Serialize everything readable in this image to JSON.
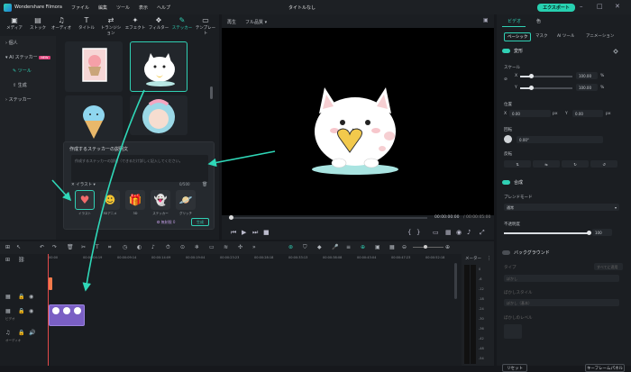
{
  "titlebar": {
    "app_name": "Wondershare Filmora",
    "menu": [
      "ファイル",
      "編集",
      "ツール",
      "表示",
      "ヘルプ"
    ],
    "doc_title": "タイトルなし",
    "export_label": "エクスポート"
  },
  "media_tabs": [
    {
      "label": "メディア",
      "icon": "media-icon"
    },
    {
      "label": "ストック",
      "icon": "stock-icon"
    },
    {
      "label": "オーディオ",
      "icon": "music-icon"
    },
    {
      "label": "タイトル",
      "icon": "text-icon"
    },
    {
      "label": "トランジション",
      "icon": "transition-icon"
    },
    {
      "label": "エフェクト",
      "icon": "effect-icon"
    },
    {
      "label": "フィルター",
      "icon": "filter-icon"
    },
    {
      "label": "ステッカー",
      "icon": "sticker-icon"
    },
    {
      "label": "テンプレート",
      "icon": "template-icon"
    }
  ],
  "sidebar": {
    "items": [
      "個人",
      "AI ステッカー",
      "ツール",
      "生成",
      "ステッカー"
    ],
    "new_badge": "NEW"
  },
  "dialog": {
    "title": "作成するステッカーの説明文",
    "placeholder": "作成するステッカーの説明（できるだけ詳しく記入してください。",
    "style_label": "イラスト",
    "counter": "0/500",
    "styles": [
      "イラスト",
      "3Dアニメ",
      "3D",
      "ステッカー",
      "グリッチ"
    ],
    "credits": "無制限",
    "credit_count": "0",
    "generate_label": "生成"
  },
  "preview": {
    "quality_label": "再生",
    "quality_value": "フル品質",
    "current_time": "00:00:00:00",
    "total_time": "00:00:05:00"
  },
  "right_panel": {
    "tabs": [
      "ビデオ",
      "色"
    ],
    "subtabs": [
      "ベーシック",
      "マスク",
      "AI ツール",
      "アニメーション"
    ],
    "transform_label": "変形",
    "scale_label": "スケール",
    "x_label": "X",
    "y_label": "Y",
    "scale_x": "100.00",
    "scale_y": "100.00",
    "scale_x_level": 0.22,
    "scale_y_level": 0.22,
    "pct": "%",
    "position_label": "位置",
    "pos_x": "0.00",
    "pos_y": "0.00",
    "px": "px",
    "rotate_label": "回転",
    "rotate_value": "0.00°",
    "flip_label": "反転",
    "composite_label": "合成",
    "blend_label": "ブレンドモード",
    "blend_value": "通常",
    "opacity_label": "不透明度",
    "opacity_value": "100",
    "opacity_level": 1.0,
    "background_label": "バックグラウンド",
    "type_label": "タイプ",
    "apply_all": "すべてに適用",
    "blur_label": "ぼかし",
    "blur_style_label": "ぼかしスタイル",
    "blur_style_value": "ぼかし（基本）",
    "blur_level_label": "ぼかしのレベル",
    "reset_label": "リセット",
    "keyframe_label": "キーフレームパネル"
  },
  "timeline": {
    "ruler": [
      "00:00",
      "00:00:04:19",
      "00:00:09:14",
      "00:00:14:09",
      "00:00:19:04",
      "00:00:23:23",
      "00:00:28:18",
      "00:00:33:13",
      "00:00:38:08",
      "00:00:43:04",
      "00:00:47:23",
      "00:00:52:18"
    ],
    "track_video": "ビデオ",
    "track_audio": "オーディオ",
    "meter_label": "メーター",
    "meter_scale": [
      "0",
      "-6",
      "-12",
      "-18",
      "-24",
      "-30",
      "-36",
      "-42",
      "-48",
      "-54"
    ]
  },
  "colors": {
    "accent": "#30d0b4",
    "clip": "#7a5fc4",
    "playhead": "#e34a4a"
  }
}
